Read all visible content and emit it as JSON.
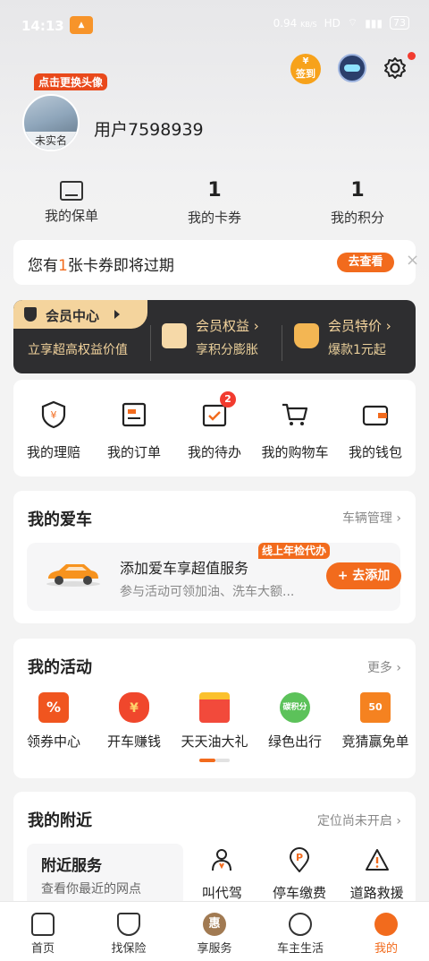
{
  "status": {
    "time": "14:13",
    "net_speed": "0.94",
    "net_unit": "KB/S",
    "battery": "73"
  },
  "header": {
    "checkin_label": "签到",
    "avatar_tip": "点击更换头像",
    "avatar_label": "未实名",
    "username": "用户7598939"
  },
  "stats": [
    {
      "value": "",
      "label": "我的保单"
    },
    {
      "value": "1",
      "label": "我的卡券"
    },
    {
      "value": "1",
      "label": "我的积分"
    }
  ],
  "notice": {
    "text_prefix": "您有",
    "count": "1",
    "text_suffix": "张卡券即将过期",
    "button": "去查看"
  },
  "vip": {
    "title": "会员中心",
    "subtitle": "立享超高权益价值",
    "benefits": [
      {
        "title": "会员权益 ›",
        "desc": "享积分膨胀"
      },
      {
        "title": "会员特价 ›",
        "desc": "爆款1元起"
      }
    ]
  },
  "quick": [
    {
      "label": "我的理赔"
    },
    {
      "label": "我的订单"
    },
    {
      "label": "我的待办",
      "badge": "2"
    },
    {
      "label": "我的购物车"
    },
    {
      "label": "我的钱包"
    }
  ],
  "car": {
    "title": "我的爱车",
    "manage": "车辆管理",
    "promo_title": "添加爱车享超值服务",
    "promo_desc": "参与活动可领加油、洗车大额...",
    "tag": "线上年检代办",
    "button": "+ 去添加"
  },
  "activities": {
    "title": "我的活动",
    "more": "更多",
    "items": [
      {
        "label": "领券中心",
        "icon_text": "%"
      },
      {
        "label": "开车赚钱",
        "icon_text": "¥"
      },
      {
        "label": "天天油大礼",
        "icon_text": ""
      },
      {
        "label": "绿色出行",
        "icon_text": "碳积分"
      },
      {
        "label": "竞猜赢免单",
        "icon_text": "50"
      }
    ]
  },
  "nearby": {
    "title": "我的附近",
    "location": "定位尚未开启",
    "service_title": "附近服务",
    "service_desc": "查看你最近的网点",
    "items": [
      {
        "label": "叫代驾"
      },
      {
        "label": "停车缴费"
      },
      {
        "label": "道路救援"
      }
    ]
  },
  "nav": [
    {
      "label": "首页"
    },
    {
      "label": "找保险"
    },
    {
      "label": "享服务",
      "icon_text": "惠"
    },
    {
      "label": "车主生活"
    },
    {
      "label": "我的"
    }
  ],
  "colors": {
    "accent": "#f26b1d",
    "vip_bg": "#2e2e30",
    "vip_gold": "#f4d49d"
  }
}
